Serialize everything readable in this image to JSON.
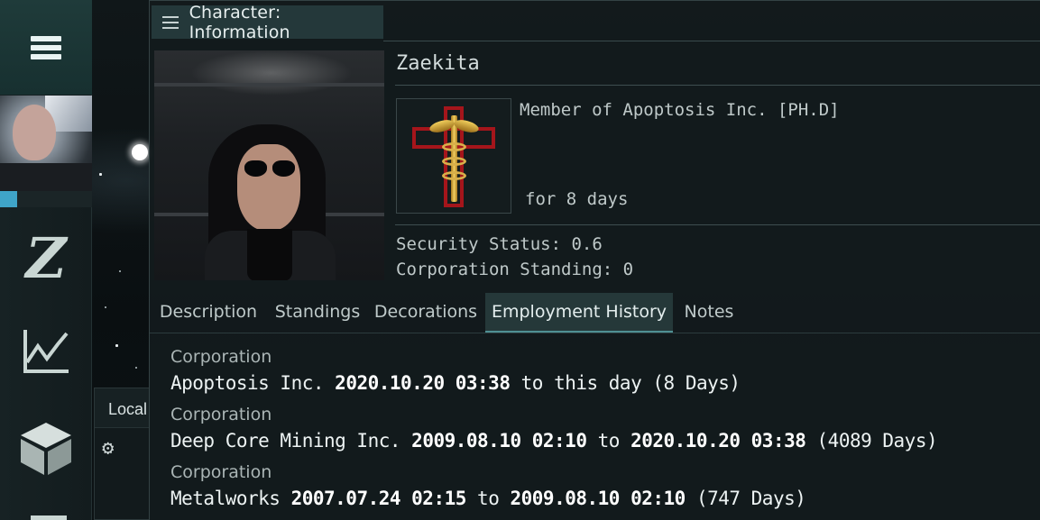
{
  "window": {
    "title": "Character: Information"
  },
  "character": {
    "name": "Zaekita",
    "corp_member_text": "Member of Apoptosis Inc. [PH.D]",
    "corp_duration_text": "for 8 days",
    "security_status": "Security Status: 0.6",
    "corporation_standing": "Corporation Standing: 0"
  },
  "tabs": [
    {
      "label": "Description",
      "active": false
    },
    {
      "label": "Standings",
      "active": false
    },
    {
      "label": "Decorations",
      "active": false
    },
    {
      "label": "Employment History",
      "active": true
    },
    {
      "label": "Notes",
      "active": false
    }
  ],
  "employment_history": [
    {
      "label": "Corporation",
      "corporation": "Apoptosis Inc.",
      "start": "2020.10.20 03:38",
      "connector": "to",
      "end": "this day",
      "duration": "(8 Days)"
    },
    {
      "label": "Corporation",
      "corporation": "Deep Core Mining Inc.",
      "start": "2009.08.10 02:10",
      "connector": "to",
      "end": "2020.10.20 03:38",
      "duration": "(4089 Days)"
    },
    {
      "label": "Corporation",
      "corporation": "Metalworks",
      "start": "2007.07.24 02:15",
      "connector": "to",
      "end": "2009.08.10 02:10",
      "duration": "(747 Days)"
    }
  ],
  "local_chat": {
    "title": "Local"
  },
  "icons": {
    "neocom_menu": "hamburger-icon",
    "skills": "z-icon",
    "market": "chart-icon",
    "inventory": "cube-icon",
    "window_menu": "hamburger-icon",
    "remove": "minus-icon",
    "settings": "gear-icon"
  },
  "colors": {
    "accent": "#4f8f93",
    "remove": "#a4161a",
    "skill_progress": "#3fa4c8"
  }
}
